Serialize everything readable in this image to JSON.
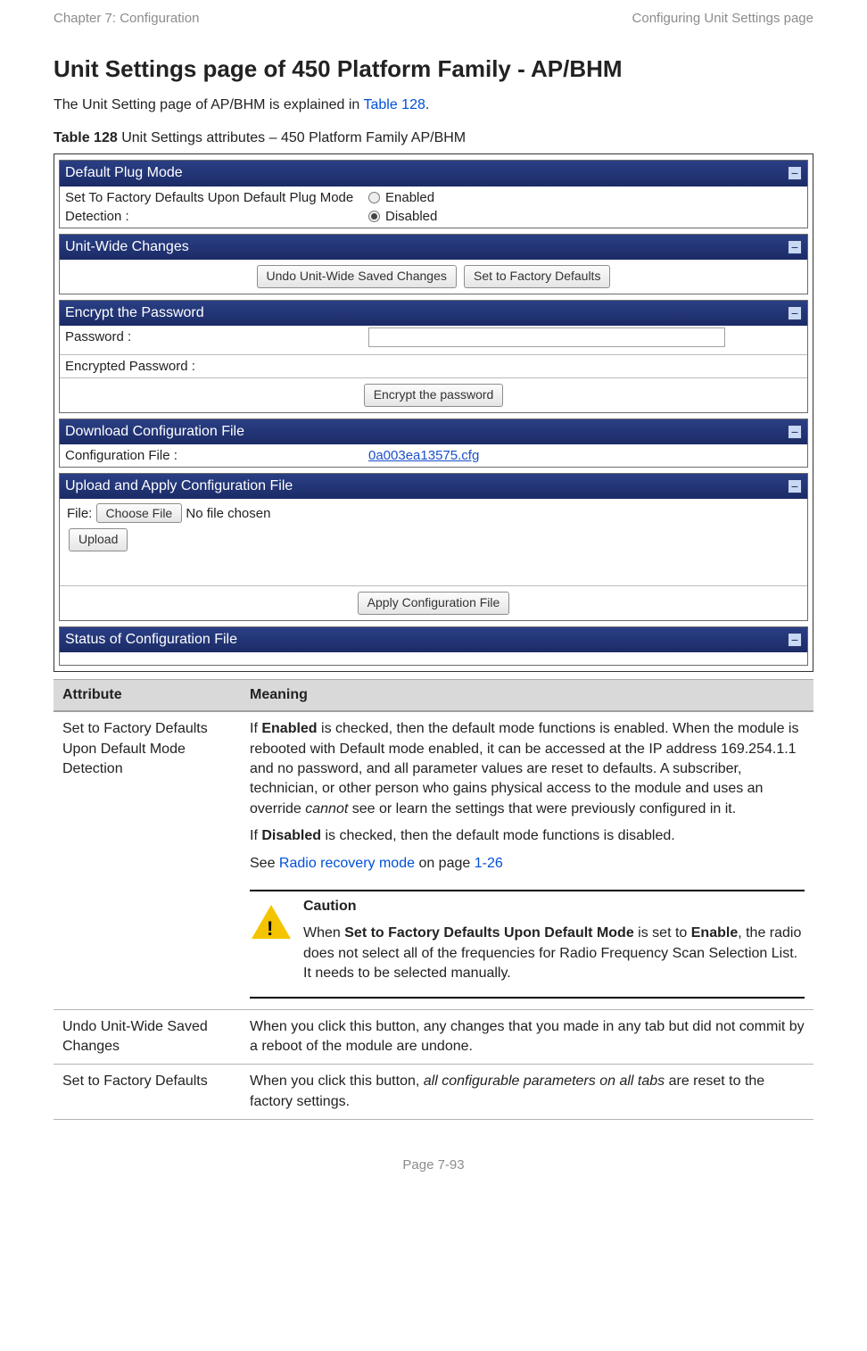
{
  "header": {
    "left": "Chapter 7:  Configuration",
    "right": "Configuring Unit Settings page"
  },
  "title": "Unit Settings page of 450 Platform Family - AP/BHM",
  "intro_prefix": "The Unit Setting page of AP/BHM is explained in ",
  "intro_link": "Table 128",
  "intro_suffix": ".",
  "table_caption_bold": "Table 128",
  "table_caption_rest": " Unit Settings attributes – 450 Platform Family AP/BHM",
  "ui": {
    "panels": {
      "default_plug": {
        "title": "Default Plug Mode",
        "label": "Set To Factory Defaults Upon Default Plug Mode Detection :",
        "opt1": "Enabled",
        "opt2": "Disabled"
      },
      "unitwide": {
        "title": "Unit-Wide Changes",
        "btn1": "Undo Unit-Wide Saved Changes",
        "btn2": "Set to Factory Defaults"
      },
      "encrypt": {
        "title": "Encrypt the Password",
        "row1": "Password :",
        "row2": "Encrypted Password :",
        "btn": "Encrypt the password"
      },
      "download": {
        "title": "Download Configuration File",
        "label": "Configuration File :",
        "file": "0a003ea13575.cfg"
      },
      "upload": {
        "title": "Upload and Apply Configuration File",
        "file_label": "File:",
        "choose": "Choose File",
        "nofile": "No file chosen",
        "upload_btn": "Upload",
        "apply_btn": "Apply Configuration File"
      },
      "status": {
        "title": "Status of Configuration File"
      }
    }
  },
  "attr_table": {
    "col1": "Attribute",
    "col2": "Meaning",
    "rows": [
      {
        "attr": "Set to Factory Defaults Upon Default Mode Detection",
        "p1a": "If ",
        "p1b": "Enabled",
        "p1c": " is checked, then the default mode functions is enabled. When the module is rebooted with Default mode enabled, it can be accessed at the IP address 169.254.1.1 and no password, and all parameter values are reset to defaults. A subscriber, technician, or other person who gains physical access to the module and uses an override ",
        "p1d_italic": "cannot",
        "p1e": " see or learn the settings that were previously configured in it.",
        "p2a": "If ",
        "p2b": "Disabled",
        "p2c": " is checked, then the default mode functions is disabled.",
        "p3_prefix": "See ",
        "p3_link": "Radio recovery mode ",
        "p3_mid": " on page ",
        "p3_page": "1-26",
        "caution_title": "Caution",
        "caution_a": "When ",
        "caution_b": "Set to Factory Defaults Upon Default Mode",
        "caution_c": " is set to ",
        "caution_d": "Enable",
        "caution_e": ", the radio does not select all of the frequencies for Radio Frequency Scan Selection List. It needs to be selected manually."
      },
      {
        "attr": "Undo Unit-Wide Saved Changes",
        "text": "When you click this button, any changes that you made in any tab but did not commit by a reboot of the module are undone."
      },
      {
        "attr": "Set to Factory Defaults",
        "text_a": "When you click this button, ",
        "text_b_italic": "all configurable parameters on all tabs",
        "text_c": " are reset to the factory settings."
      }
    ]
  },
  "footer": "Page 7-93"
}
